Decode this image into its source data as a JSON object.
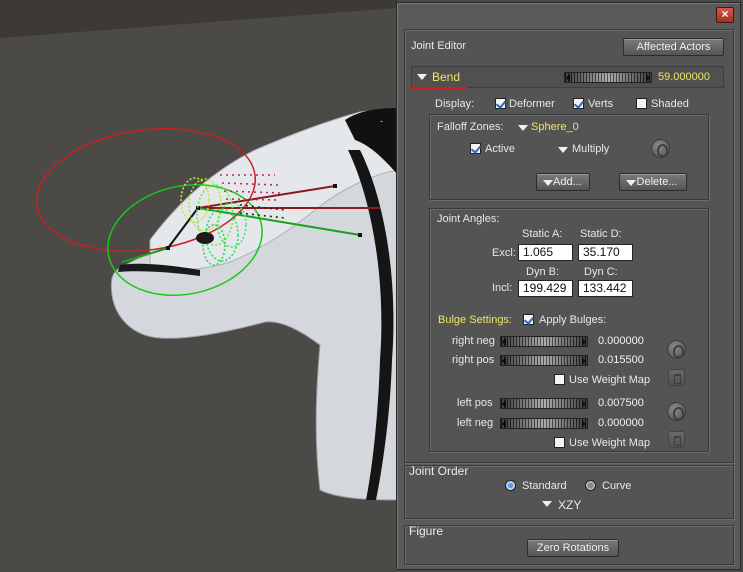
{
  "window": {
    "close_label": "×"
  },
  "joint_editor": {
    "title": "Joint Editor",
    "affected_actors_label": "Affected Actors",
    "parameter": {
      "name": "Bend",
      "value": "59.000000"
    },
    "display": {
      "label": "Display:",
      "deformer": {
        "label": "Deformer",
        "checked": true
      },
      "verts": {
        "label": "Verts",
        "checked": true
      },
      "shaded": {
        "label": "Shaded",
        "checked": false
      }
    },
    "falloff": {
      "label": "Falloff Zones:",
      "zone": "Sphere_0",
      "active": {
        "label": "Active",
        "checked": true
      },
      "mode": "Multiply",
      "add_label": "Add...",
      "delete_label": "Delete..."
    },
    "joint_angles": {
      "label": "Joint Angles:",
      "static_a_label": "Static A:",
      "static_d_label": "Static D:",
      "excl_label": "Excl:",
      "static_a": "1.065",
      "static_d": "35.170",
      "dyn_b_label": "Dyn B:",
      "dyn_c_label": "Dyn C:",
      "incl_label": "Incl:",
      "dyn_b": "199.429",
      "dyn_c": "133.442"
    },
    "bulge": {
      "label": "Bulge Settings:",
      "apply": {
        "label": "Apply Bulges:",
        "checked": true
      },
      "right_neg": {
        "label": "right neg",
        "value": "0.000000"
      },
      "right_pos": {
        "label": "right pos",
        "value": "0.015500"
      },
      "right_weight_map": {
        "label": "Use Weight Map",
        "checked": false
      },
      "left_pos": {
        "label": "left pos",
        "value": "0.007500"
      },
      "left_neg": {
        "label": "left neg",
        "value": "0.000000"
      },
      "left_weight_map": {
        "label": "Use Weight Map",
        "checked": false
      }
    },
    "joint_order": {
      "label": "Joint Order",
      "standard_label": "Standard",
      "curve_label": "Curve",
      "selected": "Standard",
      "order": "XZY"
    },
    "figure": {
      "label": "Figure",
      "zero_rotations_label": "Zero Rotations"
    }
  },
  "colors": {
    "accent_yellow": "#f1e466",
    "underline_red": "#d81c1c",
    "falloff_outer": "#c82020",
    "falloff_inner": "#18c818"
  }
}
